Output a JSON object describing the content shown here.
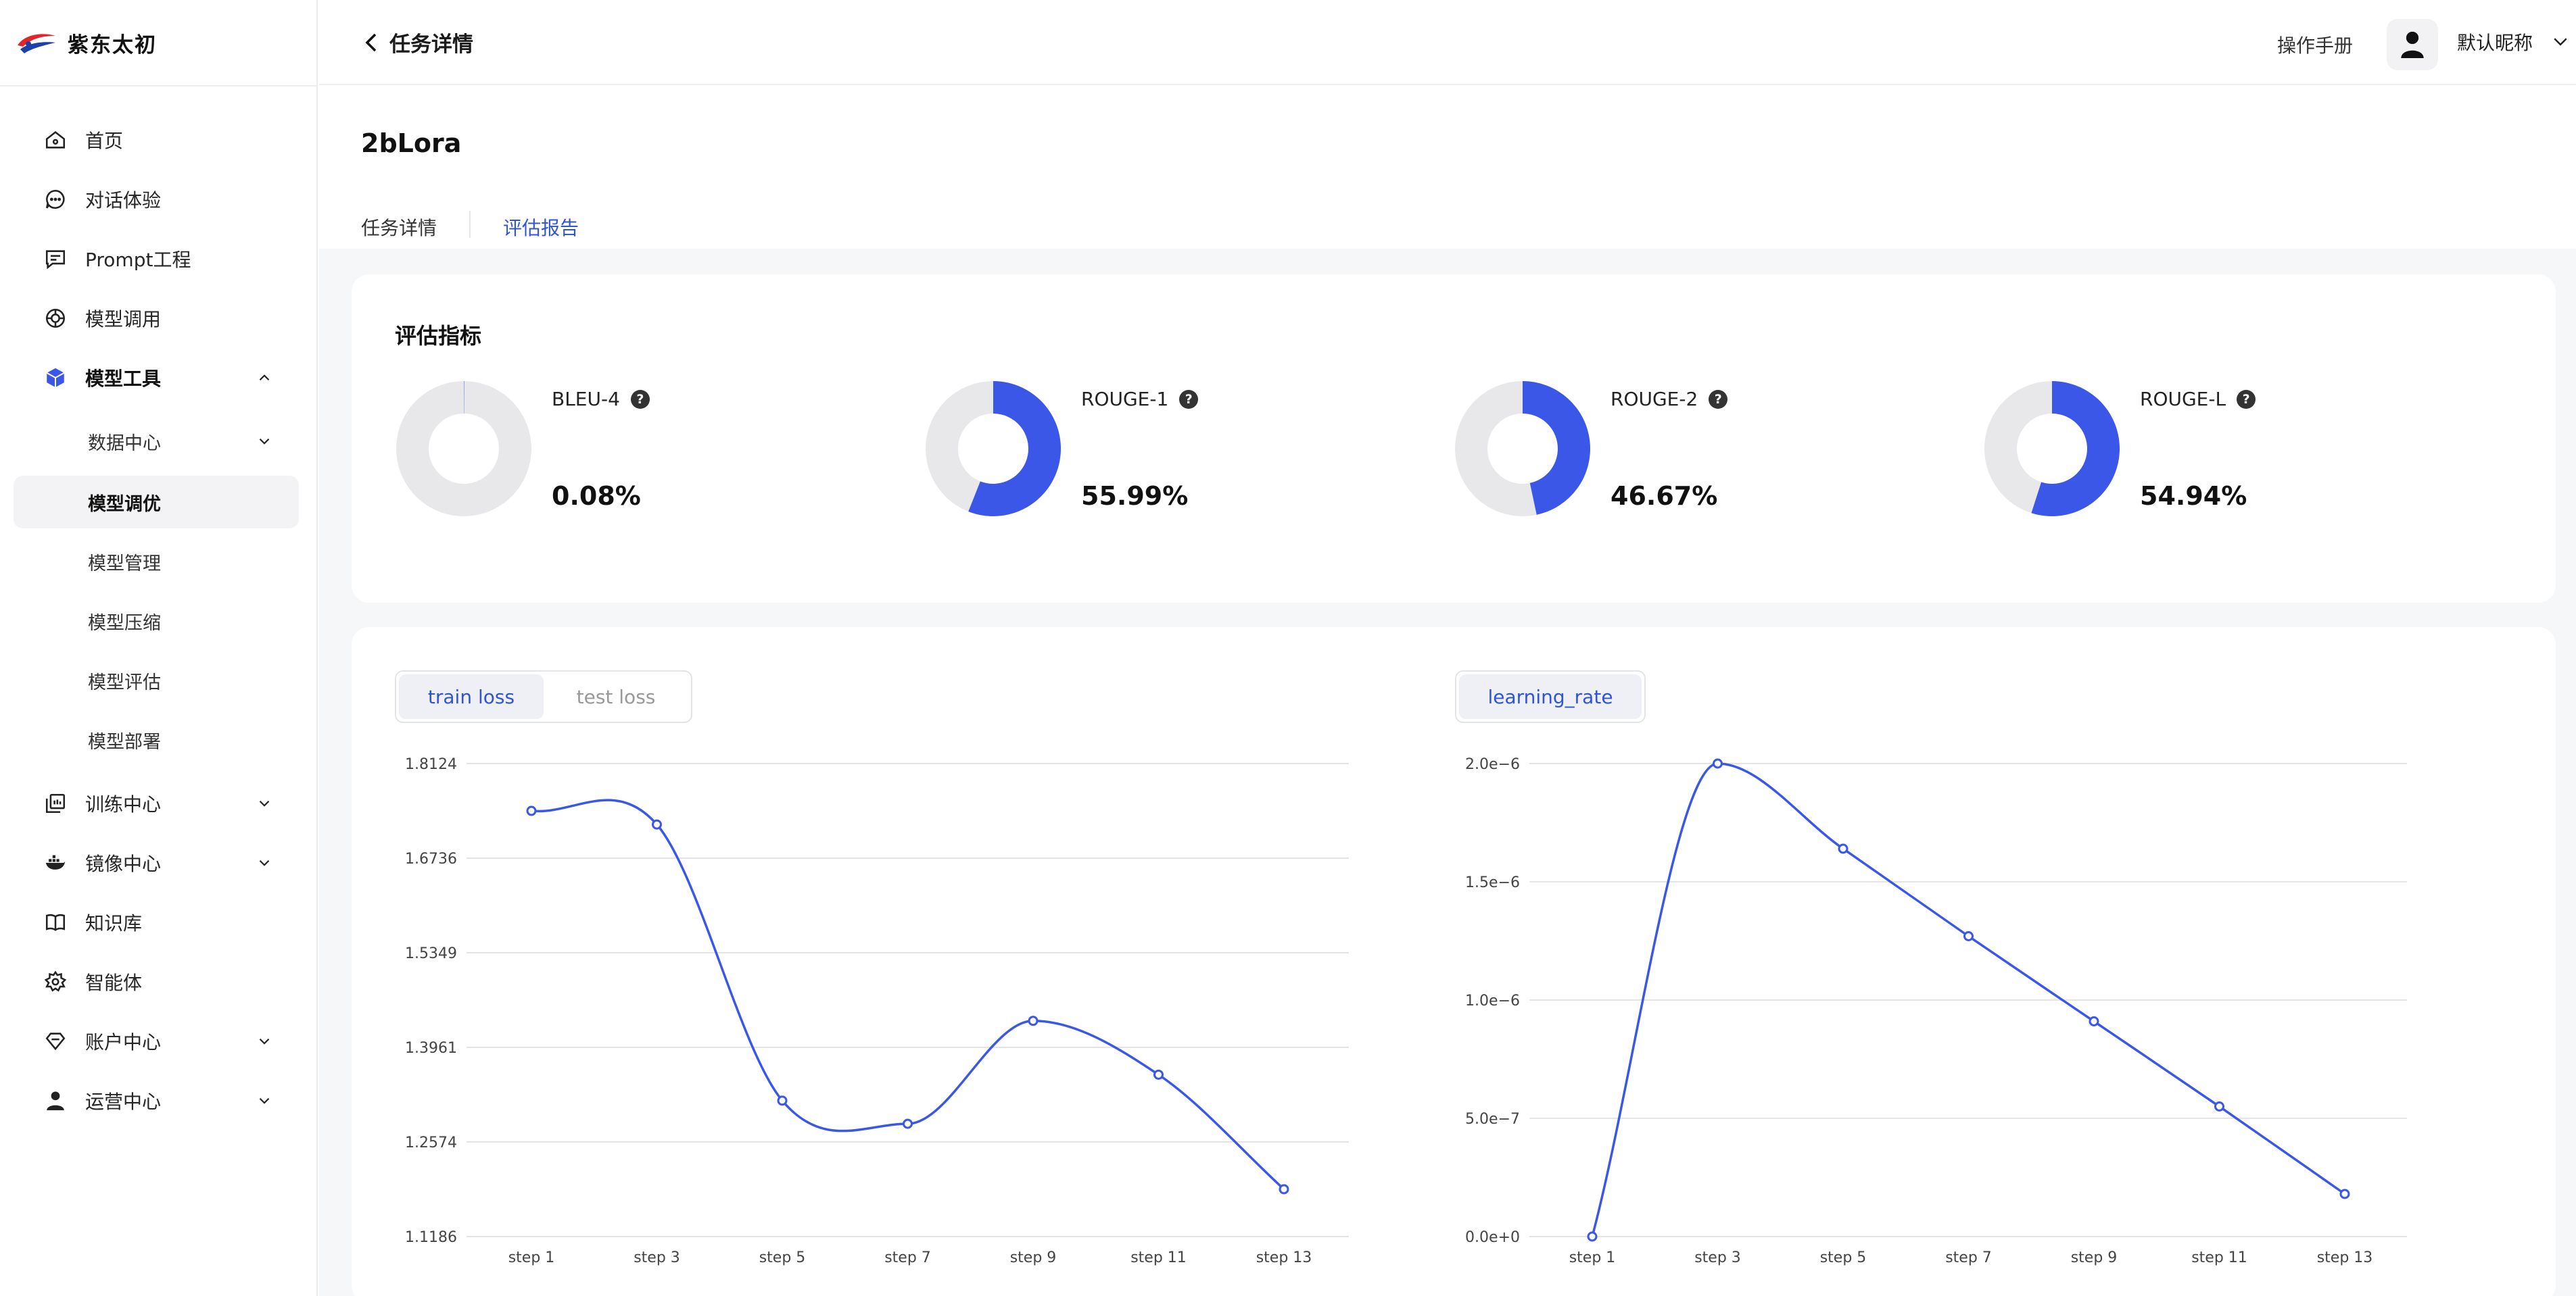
{
  "logo": {
    "text": "紫东太初"
  },
  "sidebar": {
    "items": [
      {
        "label": "首页",
        "icon": "home-icon"
      },
      {
        "label": "对话体验",
        "icon": "chat-icon"
      },
      {
        "label": "Prompt工程",
        "icon": "prompt-icon"
      },
      {
        "label": "模型调用",
        "icon": "api-icon"
      },
      {
        "label": "模型工具",
        "icon": "cube-icon",
        "expanded": true
      },
      {
        "label": "数据中心",
        "sub": true
      },
      {
        "label": "模型调优",
        "sub": true,
        "selected": true
      },
      {
        "label": "模型管理",
        "sub": true
      },
      {
        "label": "模型压缩",
        "sub": true
      },
      {
        "label": "模型评估",
        "sub": true
      },
      {
        "label": "模型部署",
        "sub": true
      },
      {
        "label": "训练中心",
        "icon": "train-icon"
      },
      {
        "label": "镜像中心",
        "icon": "docker-icon"
      },
      {
        "label": "知识库",
        "icon": "book-icon"
      },
      {
        "label": "智能体",
        "icon": "agent-gear-icon"
      },
      {
        "label": "账户中心",
        "icon": "diamond-icon"
      },
      {
        "label": "运营中心",
        "icon": "user-icon"
      }
    ]
  },
  "header": {
    "back_label": "任务详情",
    "manual_label": "操作手册",
    "nickname": "默认昵称"
  },
  "task": {
    "name": "2bLora",
    "tabs": [
      "任务详情",
      "评估报告"
    ],
    "active_tab": 1
  },
  "metrics_card": {
    "title": "评估指标",
    "metrics": [
      {
        "name": "BLEU-4",
        "value_label": "0.08%",
        "value": 0.0008
      },
      {
        "name": "ROUGE-1",
        "value_label": "55.99%",
        "value": 0.5599
      },
      {
        "name": "ROUGE-2",
        "value_label": "46.67%",
        "value": 0.4667
      },
      {
        "name": "ROUGE-L",
        "value_label": "54.94%",
        "value": 0.5494
      }
    ],
    "colors": {
      "fill": "#3a57e8",
      "track": "#e8e8ea"
    }
  },
  "loss_tabs": [
    "train loss",
    "test loss"
  ],
  "lr_tab": "learning_rate",
  "chart_data": [
    {
      "type": "line",
      "categories": [
        "step 1",
        "step 3",
        "step 5",
        "step 7",
        "step 9",
        "step 11",
        "step 13"
      ],
      "y_ticks": [
        "1.8124",
        "1.6736",
        "1.5349",
        "1.3961",
        "1.2574",
        "1.1186"
      ],
      "ylim": [
        1.1186,
        1.8124
      ],
      "values": [
        1.743,
        1.723,
        1.318,
        1.284,
        1.435,
        1.356,
        1.188
      ],
      "color": "#3a57e8",
      "grid": true
    },
    {
      "type": "line",
      "categories": [
        "step 1",
        "step 3",
        "step 5",
        "step 7",
        "step 9",
        "step 11",
        "step 13"
      ],
      "y_ticks": [
        "2.0e−6",
        "1.5e−6",
        "1.0e−6",
        "5.0e−7",
        "0.0e+0"
      ],
      "ylim": [
        0,
        2e-06
      ],
      "values": [
        0,
        2e-06,
        1.64e-06,
        1.27e-06,
        9.1e-07,
        5.5e-07,
        1.8e-07
      ],
      "color": "#3a57e8",
      "grid": true
    }
  ]
}
